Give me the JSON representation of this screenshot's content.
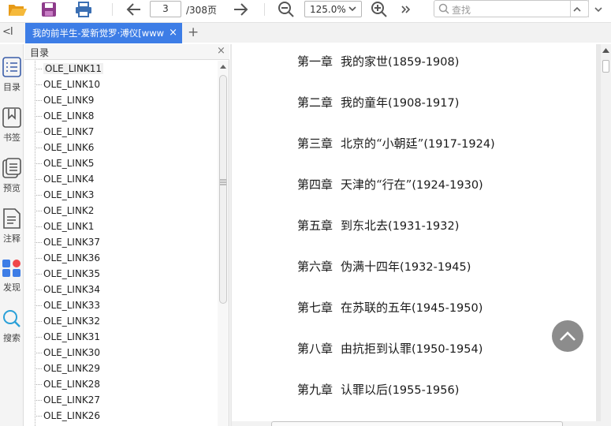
{
  "toolbar": {
    "page_current": "3",
    "page_total": "/308页",
    "zoom_value": "125.0%",
    "search_placeholder": "查找"
  },
  "tabs": [
    {
      "label": "我的前半生-爱新觉罗·溥仪[www",
      "close": "×"
    }
  ],
  "tab_add": "+",
  "rail": {
    "collapse": "<I",
    "items": [
      {
        "label": "目录",
        "icon": "toc-icon"
      },
      {
        "label": "书签",
        "icon": "bookmark-icon"
      },
      {
        "label": "预览",
        "icon": "preview-icon"
      },
      {
        "label": "注释",
        "icon": "annotation-icon"
      },
      {
        "label": "发现",
        "icon": "apps-icon"
      },
      {
        "label": "搜索",
        "icon": "search-icon"
      }
    ]
  },
  "toc": {
    "title": "目录",
    "close": "×",
    "items": [
      "OLE_LINK11",
      "OLE_LINK10",
      "OLE_LINK9",
      "OLE_LINK8",
      "OLE_LINK7",
      "OLE_LINK6",
      "OLE_LINK5",
      "OLE_LINK4",
      "OLE_LINK3",
      "OLE_LINK2",
      "OLE_LINK1",
      "OLE_LINK37",
      "OLE_LINK36",
      "OLE_LINK35",
      "OLE_LINK34",
      "OLE_LINK33",
      "OLE_LINK32",
      "OLE_LINK31",
      "OLE_LINK30",
      "OLE_LINK29",
      "OLE_LINK28",
      "OLE_LINK27",
      "OLE_LINK26"
    ]
  },
  "document": {
    "chapters": [
      {
        "num": "第一章",
        "title": "我的家世",
        "years": "(1859-1908)"
      },
      {
        "num": "第二章",
        "title": "我的童年",
        "years": "(1908-1917)"
      },
      {
        "num": "第三章",
        "title": "北京的“小朝廷”",
        "years": "(1917-1924)"
      },
      {
        "num": "第四章",
        "title": "天津的“行在”",
        "years": "(1924-1930)"
      },
      {
        "num": "第五章",
        "title": "到东北去",
        "years": "(1931-1932)"
      },
      {
        "num": "第六章",
        "title": "伪满十四年",
        "years": "(1932-1945)"
      },
      {
        "num": "第七章",
        "title": "在苏联的五年",
        "years": "(1945-1950)"
      },
      {
        "num": "第八章",
        "title": "由抗拒到认罪",
        "years": "(1950-1954)"
      },
      {
        "num": "第九章",
        "title": "认罪以后",
        "years": "(1955-1956)"
      }
    ]
  },
  "colors": {
    "tab_active": "#3d7de6",
    "open_icon": "#f0a21e",
    "save_icon": "#8e3b8b",
    "print_icon": "#3b6fb3",
    "fab": "#8c8c8c"
  }
}
